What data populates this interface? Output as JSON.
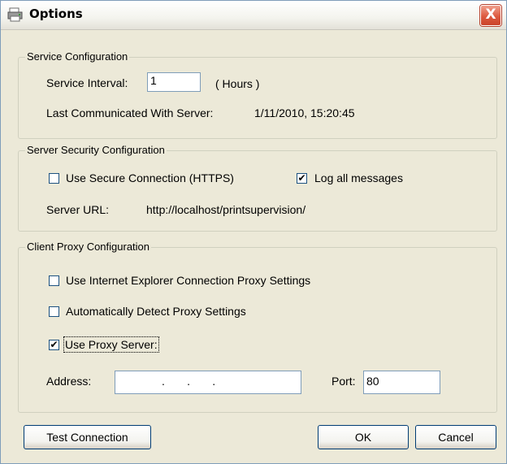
{
  "window": {
    "title": "Options",
    "close_label": "X"
  },
  "service_config": {
    "legend": "Service Configuration",
    "interval_label": "Service Interval:",
    "interval_value": "1",
    "interval_unit": "( Hours )",
    "last_comm_label": "Last Communicated With Server:",
    "last_comm_value": "1/11/2010, 15:20:45"
  },
  "security_config": {
    "legend": "Server Security Configuration",
    "secure_label": "Use Secure Connection (HTTPS)",
    "secure_checked": false,
    "log_label": "Log all messages",
    "log_checked": true,
    "url_label": "Server URL:",
    "url_value": "http://localhost/printsupervision/"
  },
  "proxy_config": {
    "legend": "Client Proxy Configuration",
    "ie_label": "Use Internet Explorer Connection Proxy Settings",
    "ie_checked": false,
    "auto_label": "Automatically Detect Proxy Settings",
    "auto_checked": false,
    "use_proxy_label": "Use Proxy Server:",
    "use_proxy_checked": true,
    "address_label": "Address:",
    "address_value": ".       .       .",
    "port_label": "Port:",
    "port_value": "80"
  },
  "buttons": {
    "test": "Test Connection",
    "ok": "OK",
    "cancel": "Cancel"
  },
  "check_mark": "✔",
  "colors": {
    "close_button": "#dd5a3f",
    "dialog_bg": "#ece9d8",
    "border": "#7f9db9"
  }
}
